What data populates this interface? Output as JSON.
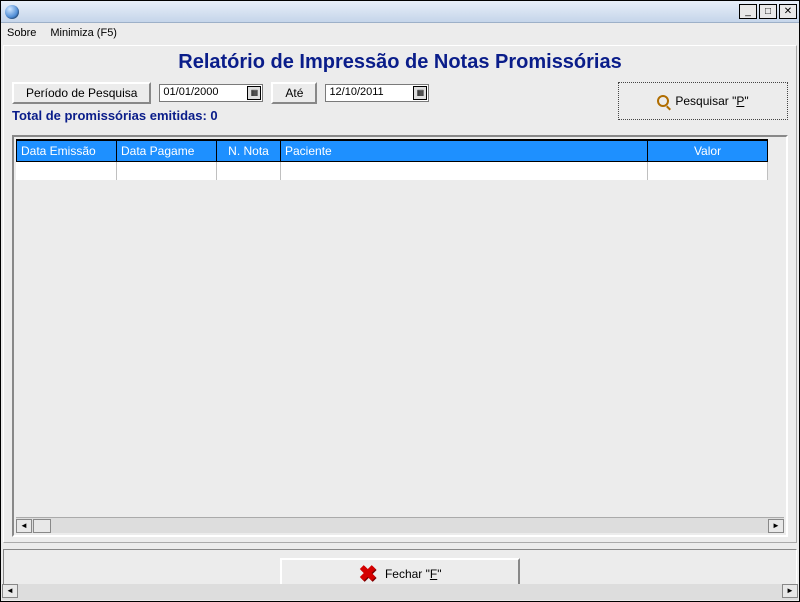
{
  "menu": {
    "sobre": "Sobre",
    "minimiza": "Minimiza (F5)"
  },
  "title": "Relatório de Impressão de Notas Promissórias",
  "search": {
    "periodo_label": "Período de Pesquisa",
    "date_from": "01/01/2000",
    "ate_label": "Até",
    "date_to": "12/10/2011",
    "button_label": "Pesquisar \"",
    "button_key": "P",
    "button_suffix": "\""
  },
  "total_label": "Total de promissórias emitidas: 0",
  "columns": {
    "data_emissao": "Data Emissão",
    "data_pagamento": "Data Pagame",
    "n_nota": "N. Nota",
    "paciente": "Paciente",
    "valor": "Valor"
  },
  "footer": {
    "close_label": "Fechar \"",
    "close_key": "F",
    "close_suffix": "\""
  },
  "winbtn": {
    "min": "_",
    "max": "□",
    "close": "✕"
  }
}
